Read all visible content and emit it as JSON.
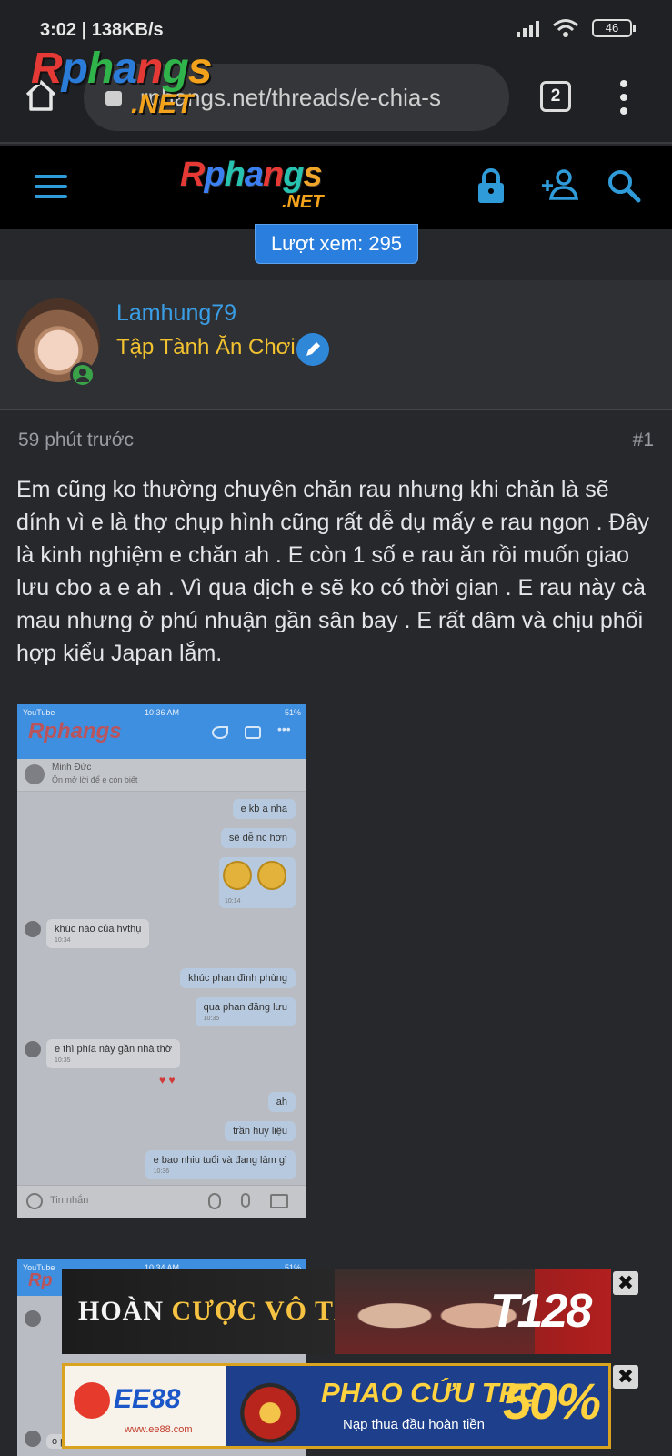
{
  "statusbar": {
    "time": "3:02 | 138KB/s",
    "battery": "46"
  },
  "browser": {
    "url": "rphangs.net/threads/e-chia-s",
    "tab_count": "2"
  },
  "watermark": {
    "logo_main": "Rphangs",
    "logo_sub": ".NET"
  },
  "site": {
    "logo_main": "Rphangs",
    "logo_sub": ".NET",
    "icons": [
      "menu-icon",
      "lock-icon",
      "add-user-icon",
      "search-icon"
    ],
    "accent": "#2f9bd8"
  },
  "thread": {
    "views_label": "Lượt xem: 295"
  },
  "user": {
    "name": "Lamhung79",
    "title": "Tập Tành Ăn Chơi",
    "name_color": "#3a9ee6",
    "title_color": "#f2c230"
  },
  "post": {
    "time": "59 phút trước",
    "number": "#1",
    "body": "Em cũng ko thường chuyên chăn rau nhưng khi chăn là sẽ dính vì e là thợ chụp hình cũng rất dễ dụ mấy e rau ngon . Đây là kinh nghiệm e chăn ah . E còn 1 số e rau ăn rồi muốn giao lưu cbo a e ah . Vì qua dịch e sẽ ko có thời gian . E rau này cà mau nhưng ở phú nhuận gần sân bay . E rất dâm và chịu phối hợp kiểu Japan lắm."
  },
  "chat_screenshot_1": {
    "status_left": "YouTube",
    "status_time": "10:36 AM",
    "status_right": "51%",
    "logo": "Rphangs",
    "contact_name": "Minh Đức",
    "contact_sub": "Ôn mở lời để e còn biết",
    "messages": [
      {
        "side": "me",
        "text": "e kb a nha",
        "time": ""
      },
      {
        "side": "me",
        "text": "sẽ dễ nc hơn",
        "time": ""
      },
      {
        "side": "me",
        "text": "😊😊",
        "time": "10:14"
      },
      {
        "side": "them",
        "text": "khúc nào của hvthụ",
        "time": "10:34"
      },
      {
        "side": "me",
        "text": "khúc phan đình phùng",
        "time": ""
      },
      {
        "side": "me",
        "text": "qua phan đăng lưu",
        "time": "10:35"
      },
      {
        "side": "them",
        "text": "e thì phía này gần nhà thờ",
        "time": "10:35"
      },
      {
        "side": "me",
        "text": "ah",
        "time": ""
      },
      {
        "side": "me",
        "text": "trần huy liệu",
        "time": ""
      },
      {
        "side": "me",
        "text": "e bao nhiu tuổi và đang làm gì",
        "time": "10:36"
      }
    ],
    "input_placeholder": "Tin nhắn"
  },
  "chat_screenshot_2": {
    "status_left": "YouTube",
    "status_time": "10:34 AM",
    "status_right": "51%",
    "logo": "Rp",
    "last_text": "o phú nhuận"
  },
  "ads": [
    {
      "text_white": "HOÀN ",
      "text_yellow": "CƯỢC VÔ TẬN",
      "brand": "T128",
      "close": "✖"
    },
    {
      "brand": "EE88",
      "site": "www.ee88.com",
      "headline": "PHAO CỨU TRỢ",
      "sub": "Nạp thua đầu hoàn tiền",
      "percent": "50%",
      "close": "✖"
    }
  ]
}
